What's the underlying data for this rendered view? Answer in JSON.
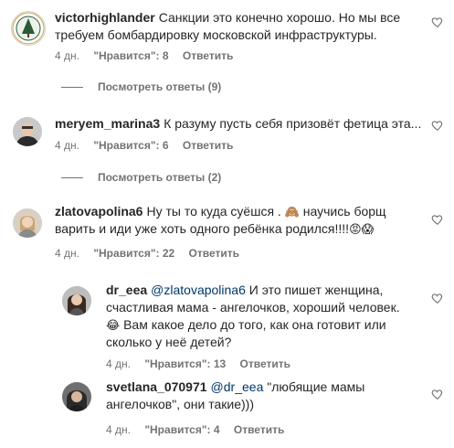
{
  "comments": [
    {
      "username": "victorhighlander",
      "text": "Санкции это конечно хорошо. Но мы все требуем бомбардировку московской инфраструктуры.",
      "line1": "Санкции это конечно хорошо. Но мы все",
      "line2": "требуем бомбардировку московской инфраструктуры.",
      "time": "4 дн.",
      "likes": "\"Нравится\": 8",
      "reply": "Ответить",
      "view_replies": "Посмотреть ответы (9)"
    },
    {
      "username": "meryem_marina3",
      "line1": "К разуму пусть себя призовёт фетица эта...",
      "time": "4 дн.",
      "likes": "\"Нравится\": 6",
      "reply": "Ответить",
      "view_replies": "Посмотреть ответы (2)"
    },
    {
      "username": "zlatovapolina6",
      "line1a": "Ну ты то куда суёшся .",
      "line1b": "научись борщ",
      "line2": "варить и иди уже хоть одного ребёнка родился!!!!",
      "emoji1": "🙈",
      "emoji2": "😡",
      "emoji3": "😱",
      "time": "4 дн.",
      "likes": "\"Нравится\": 22",
      "reply": "Ответить"
    }
  ],
  "replies": [
    {
      "username": "dr_eea",
      "mention": "@zlatovapolina6",
      "line1": "И это пишет женщина,",
      "line2": "счастливая мама - ангелочков, хороший человек.",
      "line3": "Вам какое дело до того, как она готовит или",
      "line4": "сколько у неё детей?",
      "emoji": "😂",
      "time": "4 дн.",
      "likes": "\"Нравится\": 13",
      "reply": "Ответить"
    },
    {
      "username": "svetlana_070971",
      "mention": "@dr_eea",
      "line1": "\"любящие мамы",
      "line2": "ангелочков\", они такие)))",
      "time": "4 дн.",
      "likes": "\"Нравится\": 4",
      "reply": "Ответить"
    }
  ],
  "colors": {
    "text": "#262626",
    "meta": "#737373",
    "mention": "#00376b"
  }
}
